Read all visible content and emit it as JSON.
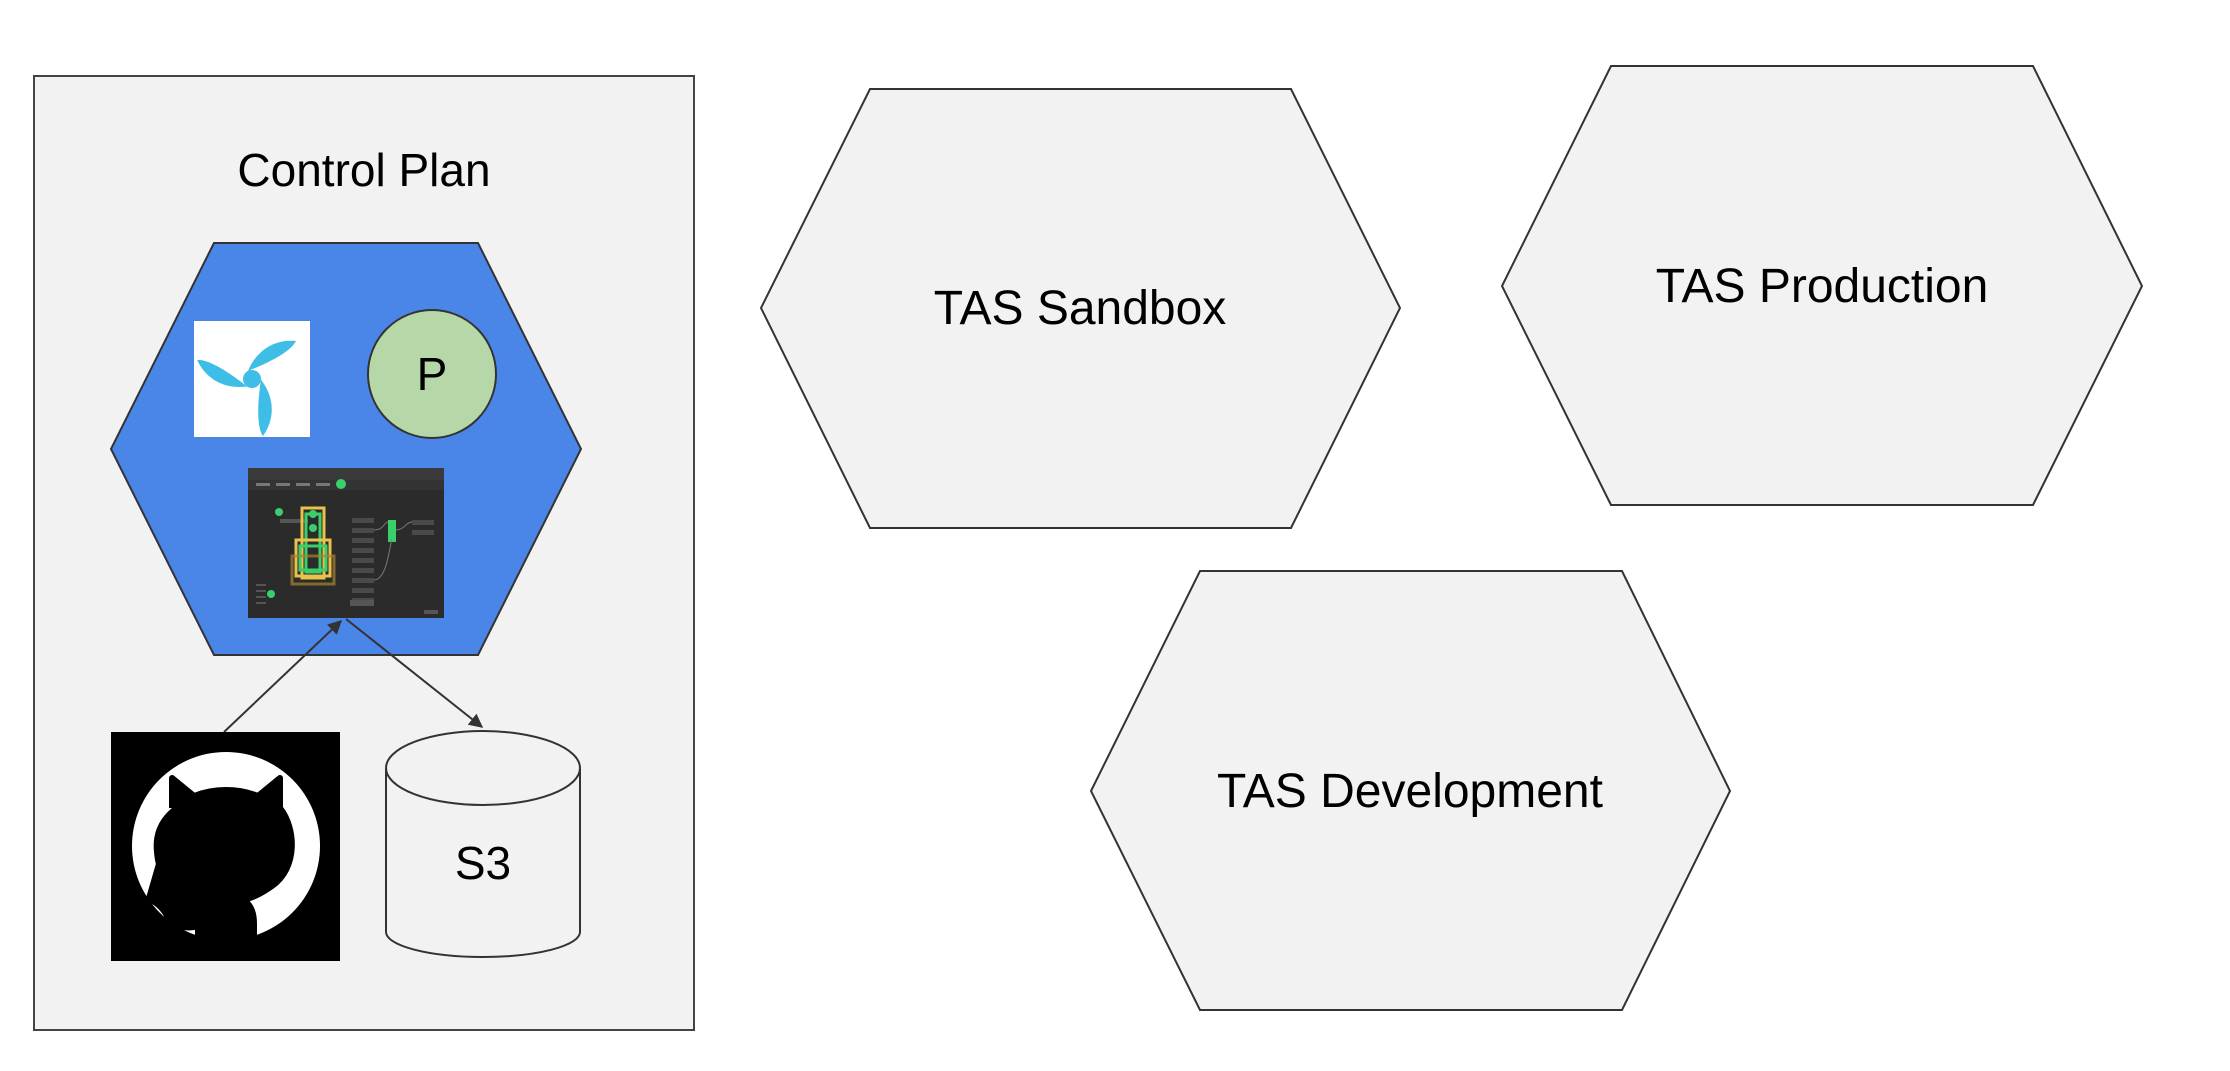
{
  "control_plan": {
    "title": "Control Plan",
    "badge_letter": "P",
    "storage_label": "S3"
  },
  "environments": {
    "sandbox": "TAS Sandbox",
    "production": "TAS Production",
    "development": "TAS Development"
  },
  "icons": {
    "pipeline_logo": "concourse-propeller-icon",
    "repository": "github-octocat-icon",
    "storage": "cylinder-database-icon",
    "pipeline_ui": "pipeline-dashboard-screenshot"
  },
  "colors": {
    "page_background": "#ffffff",
    "panel_fill": "#f2f2f2",
    "hexagon_fill": "#f2f2f2",
    "cluster_fill": "#4a86e8",
    "badge_fill": "#b6d7a8",
    "logo_accent": "#3ebee6",
    "dashboard_bg": "#2b2b2b",
    "dashboard_green": "#3bcf6b",
    "dashboard_yellow": "#e8c24a",
    "stroke": "#333333"
  }
}
